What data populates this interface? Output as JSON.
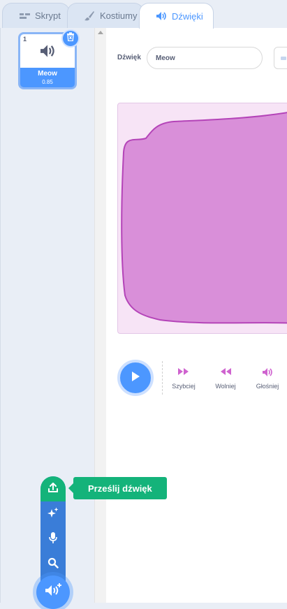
{
  "tabs": [
    {
      "label": "Skrypt",
      "icon": "code-icon",
      "active": false
    },
    {
      "label": "Kostiumy",
      "icon": "brush-icon",
      "active": false
    },
    {
      "label": "Dźwięki",
      "icon": "speaker-icon",
      "active": true
    }
  ],
  "sound_list": {
    "items": [
      {
        "number": "1",
        "name": "Meow",
        "duration": "0.85",
        "selected": true
      }
    ]
  },
  "editor": {
    "name_label": "Dźwięk",
    "name_value": "Meow",
    "effects": [
      {
        "label": "Szybciej",
        "icon": "faster-icon"
      },
      {
        "label": "Wolniej",
        "icon": "slower-icon"
      },
      {
        "label": "Głośniej",
        "icon": "louder-icon"
      }
    ],
    "waveform_color": "#d98fd9",
    "waveform_stroke": "#b444b8"
  },
  "add_sound_menu": {
    "tooltip": "Prześlij dźwięk",
    "items": [
      "upload-icon",
      "surprise-icon",
      "record-icon",
      "search-icon"
    ],
    "main_icon": "add-sound-icon"
  },
  "colors": {
    "accent": "#4c97ff",
    "upload_green": "#14b37a",
    "menu_blue": "#3a7dd8",
    "effect_pink": "#cf63cf"
  }
}
